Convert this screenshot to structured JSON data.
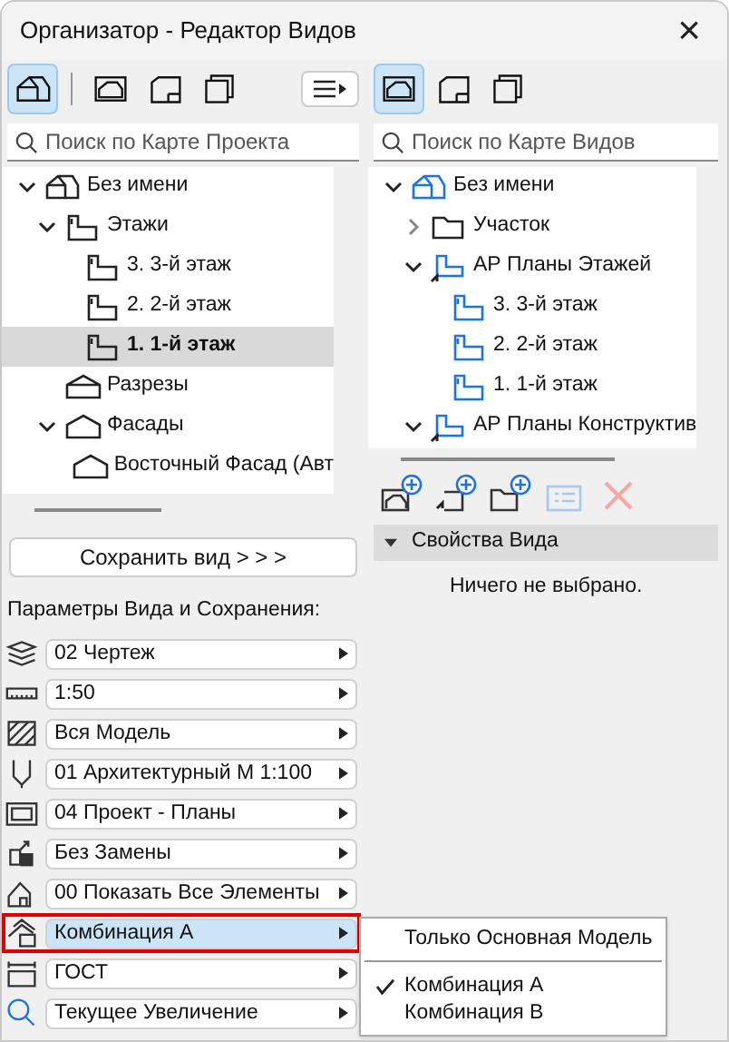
{
  "window": {
    "title": "Организатор - Редактор Видов",
    "close": "×"
  },
  "left": {
    "toolbar": [
      {
        "kind": "project",
        "selected": true
      },
      {
        "kind": "views",
        "selected": false
      },
      {
        "kind": "layouts",
        "selected": false
      },
      {
        "kind": "publisher",
        "selected": false
      }
    ],
    "search": {
      "placeholder": "Поиск по Карте Проекта"
    },
    "tree": [
      {
        "label": "Без имени",
        "kind": "project",
        "expanded": true,
        "selected": false,
        "children": [
          {
            "label": "Этажи",
            "kind": "floor",
            "expanded": true,
            "selected": false,
            "children": [
              {
                "label": "3. 3-й этаж",
                "kind": "floor",
                "selected": false
              },
              {
                "label": "2. 2-й этаж",
                "kind": "floor",
                "selected": false
              },
              {
                "label": "1. 1-й этаж",
                "kind": "floor",
                "selected": true
              }
            ]
          },
          {
            "label": "Разрезы",
            "kind": "section",
            "selected": false
          },
          {
            "label": "Фасады",
            "kind": "elevation",
            "expanded": true,
            "selected": false,
            "children": [
              {
                "label": "Восточный Фасад (Авт",
                "kind": "elevation",
                "selected": false
              }
            ]
          }
        ]
      }
    ],
    "save_button": "Сохранить вид > > >",
    "params_title": "Параметры Вида и Сохранения:",
    "params": [
      {
        "kind": "layers",
        "value": "02 Чертеж",
        "selected": false
      },
      {
        "kind": "scale",
        "value": "1:50",
        "selected": false
      },
      {
        "kind": "model",
        "value": "Вся Модель",
        "selected": false
      },
      {
        "kind": "pen",
        "value": "01 Архитектурный М 1:100",
        "selected": false
      },
      {
        "kind": "frame",
        "value": "04 Проект - Планы",
        "selected": false
      },
      {
        "kind": "override",
        "value": "Без Замены",
        "selected": false
      },
      {
        "kind": "filter",
        "value": "00 Показать Все Элементы",
        "selected": false
      },
      {
        "kind": "combination",
        "value": "Комбинация А",
        "selected": true
      },
      {
        "kind": "dimension",
        "value": "ГОСТ",
        "selected": false
      },
      {
        "kind": "zoom",
        "value": "Текущее Увеличение",
        "selected": false
      }
    ]
  },
  "right": {
    "toolbar": [
      {
        "kind": "views",
        "selected": true
      },
      {
        "kind": "layouts",
        "selected": false
      },
      {
        "kind": "publisher",
        "selected": false
      }
    ],
    "search": {
      "placeholder": "Поиск по Карте Видов"
    },
    "tree": [
      {
        "label": "Без имени",
        "kind": "project",
        "expanded": true,
        "selected": false,
        "children": [
          {
            "label": "Участок",
            "kind": "folder",
            "expanded": false,
            "selected": false
          },
          {
            "label": "АР Планы Этажей",
            "kind": "viewset",
            "expanded": true,
            "selected": false,
            "children": [
              {
                "label": "3. 3-й этаж",
                "kind": "floor",
                "selected": false
              },
              {
                "label": "2. 2-й этаж",
                "kind": "floor",
                "selected": false
              },
              {
                "label": "1. 1-й этаж",
                "kind": "floor",
                "selected": false
              }
            ]
          },
          {
            "label": "АР Планы Конструктив",
            "kind": "viewset",
            "expanded": true,
            "selected": false
          }
        ]
      }
    ],
    "actions": [
      {
        "kind": "new-view",
        "disabled": false
      },
      {
        "kind": "clone",
        "disabled": false
      },
      {
        "kind": "new-folder",
        "disabled": false
      },
      {
        "kind": "settings",
        "disabled": true
      },
      {
        "kind": "delete",
        "disabled": true
      }
    ],
    "properties": {
      "title": "Свойства Вида",
      "expanded": true,
      "message": "Ничего не выбрано."
    }
  },
  "menu": {
    "groups": [
      [
        {
          "label": "Только Основная Модель",
          "checked": false
        }
      ],
      [
        {
          "label": "Комбинация А",
          "checked": true
        },
        {
          "label": "Комбинация В",
          "checked": false
        }
      ]
    ]
  }
}
